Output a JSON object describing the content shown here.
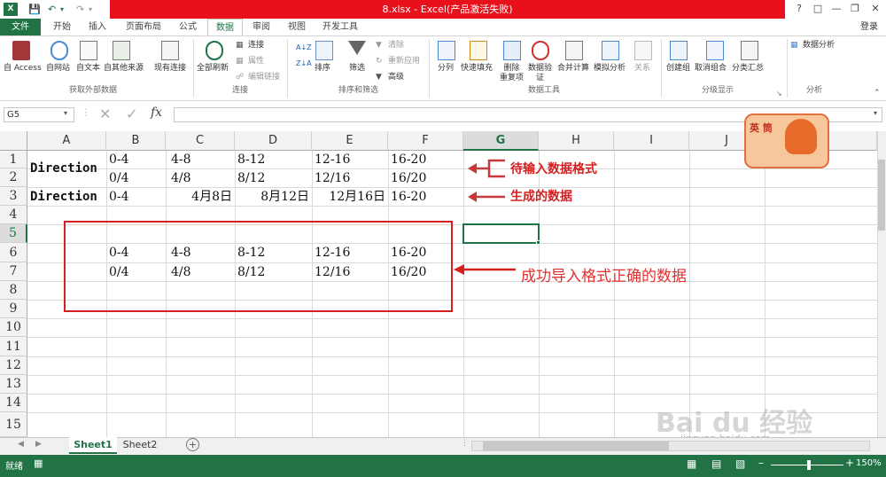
{
  "title": {
    "text": "8.xlsx -  Excel(产品激活失败)",
    "help": "?",
    "login": "登录"
  },
  "tabs": [
    "文件",
    "开始",
    "插入",
    "页面布局",
    "公式",
    "数据",
    "审阅",
    "视图",
    "开发工具"
  ],
  "ribbon": {
    "ext_data": [
      "自 Access",
      "自网站",
      "自文本",
      "自其他来源",
      "现有连接"
    ],
    "ext_group": "获取外部数据",
    "refresh": "全部刷新",
    "conn_items": [
      "连接",
      "属性",
      "编辑链接"
    ],
    "conn_group": "连接",
    "sort_az": "A↓Z",
    "sort": "排序",
    "filter": "筛选",
    "filter_items": [
      "清除",
      "重新应用",
      "高级"
    ],
    "sort_group": "排序和筛选",
    "tools": [
      "分列",
      "快速填充",
      "删除\n重复项",
      "数据验\n证",
      "合并计算",
      "模拟分析",
      "关系"
    ],
    "tools_group": "数据工具",
    "outline": [
      "创建组",
      "取消组合",
      "分类汇总"
    ],
    "outline_group": "分级显示",
    "analysis": "数据分析",
    "analysis_group": "分析"
  },
  "namebox": "G5",
  "fx": "fx",
  "columns": [
    "A",
    "B",
    "C",
    "D",
    "E",
    "F",
    "G",
    "H",
    "I",
    "J"
  ],
  "rows": [
    "1",
    "2",
    "3",
    "4",
    "5",
    "6",
    "7",
    "8",
    "9",
    "10",
    "11",
    "12",
    "13",
    "14",
    "15"
  ],
  "cells": {
    "a1": "Direction",
    "a3": "Direction",
    "r1": [
      "0-4",
      "4-8",
      "8-12",
      "12-16",
      "16-20"
    ],
    "r2": [
      "0/4",
      "4/8",
      "8/12",
      "12/16",
      "16/20"
    ],
    "r3": [
      "0-4",
      "4月8日",
      "8月12日",
      "12月16日",
      "16-20"
    ],
    "r6": [
      "0-4",
      "4-8",
      "8-12",
      "12-16",
      "16-20"
    ],
    "r7": [
      "0/4",
      "4/8",
      "8/12",
      "12/16",
      "16/20"
    ]
  },
  "annotations": {
    "input_format": "待输入数据格式",
    "generated": "生成的数据",
    "success": "成功导入格式正确的数据"
  },
  "sticker": "英 筒",
  "sheets": [
    "Sheet1",
    "Sheet2"
  ],
  "status": {
    "ready": "就绪",
    "zoom": "150%"
  },
  "watermark": {
    "main": "Bai du 经验",
    "sub": "jingyan.baidu.com"
  },
  "colors": {
    "excel_green": "#217346",
    "title_red": "#e8101a",
    "annotation_red": "#d42020"
  }
}
